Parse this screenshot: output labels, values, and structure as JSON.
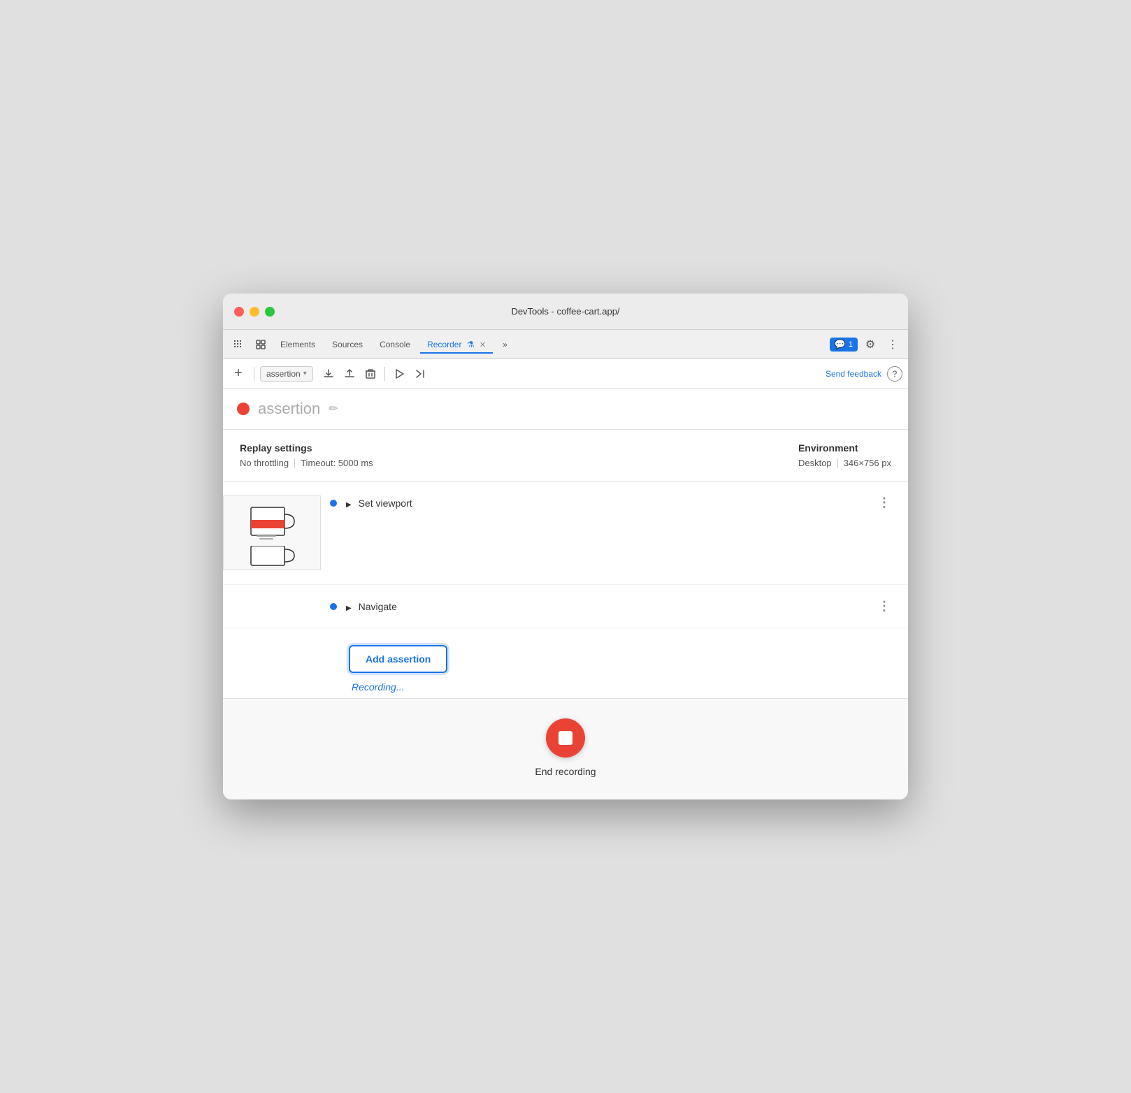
{
  "window": {
    "title": "DevTools - coffee-cart.app/"
  },
  "tabs": {
    "items": [
      {
        "label": "Elements",
        "active": false
      },
      {
        "label": "Sources",
        "active": false
      },
      {
        "label": "Console",
        "active": false
      },
      {
        "label": "Recorder",
        "active": true
      },
      {
        "label": "»",
        "active": false
      }
    ],
    "chat_badge": "1",
    "close_icon": "✕"
  },
  "toolbar": {
    "recording_name": "assertion",
    "send_feedback": "Send feedback",
    "help_icon": "?"
  },
  "recording_header": {
    "name": "assertion",
    "edit_icon": "✏"
  },
  "settings": {
    "title_left": "Replay settings",
    "throttling": "No throttling",
    "timeout": "Timeout: 5000 ms",
    "title_right": "Environment",
    "env": "Desktop",
    "resolution": "346×756 px"
  },
  "steps": [
    {
      "label": "Set viewport",
      "has_preview": true
    },
    {
      "label": "Navigate",
      "has_preview": false
    }
  ],
  "add_assertion": {
    "button_label": "Add assertion",
    "status": "Recording..."
  },
  "end_recording": {
    "label": "End recording"
  }
}
